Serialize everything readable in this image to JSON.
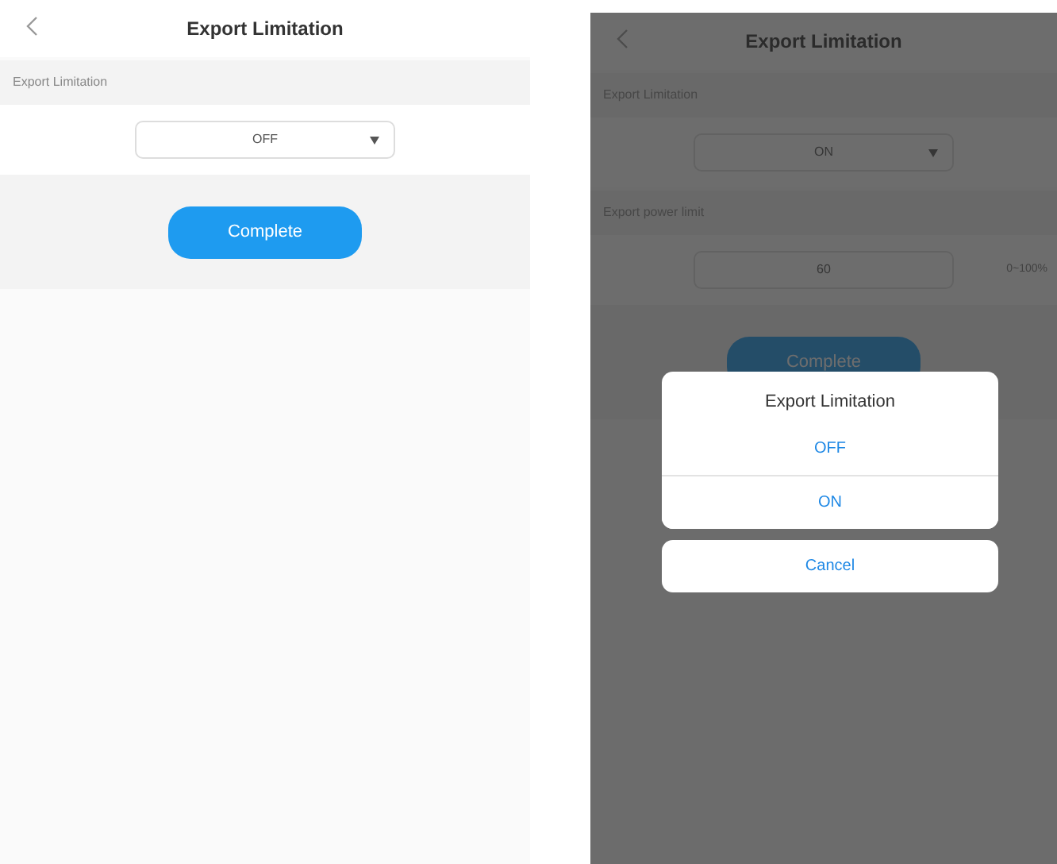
{
  "screens": [
    {
      "title": "Export Limitation",
      "fields": [
        {
          "kind": "select",
          "label": "Export Limitation",
          "value": "OFF"
        }
      ],
      "button": "Complete",
      "dimmed": false
    },
    {
      "title": "Export Limitation",
      "fields": [
        {
          "kind": "select",
          "label": "Export Limitation",
          "value": "ON"
        },
        {
          "kind": "input",
          "label": "Export power limit",
          "value": "60",
          "unit": "0~100%"
        }
      ],
      "button": "Complete",
      "dimmed": true,
      "action_sheet": {
        "title": "Export Limitation",
        "options": [
          {
            "label": "OFF"
          },
          {
            "label": "ON"
          }
        ],
        "cancel": "Cancel"
      }
    }
  ]
}
